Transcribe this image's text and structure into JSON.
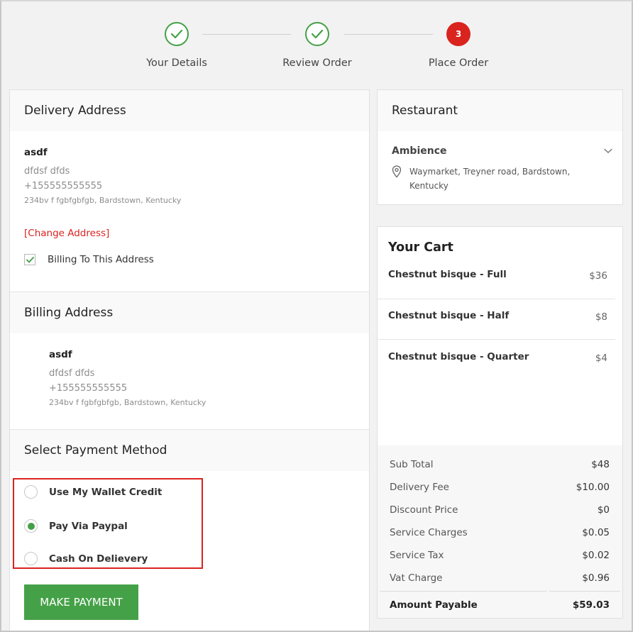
{
  "steps": [
    {
      "label": "Your Details",
      "status": "done"
    },
    {
      "label": "Review Order",
      "status": "done"
    },
    {
      "label": "Place Order",
      "status": "current",
      "number": "3"
    }
  ],
  "delivery": {
    "title": "Delivery Address",
    "name": "asdf",
    "line1": "dfdsf dfds",
    "phone": "+155555555555",
    "address": "234bv f fgbfgbfgb, Bardstown, Kentucky",
    "change_link": "[Change Address]",
    "billing_checkbox_label": "Billing To This Address",
    "billing_checked": true
  },
  "billing": {
    "title": "Billing Address",
    "name": "asdf",
    "line1": "dfdsf dfds",
    "phone": "+155555555555",
    "address": "234bv f fgbfgbfgb, Bardstown, Kentucky"
  },
  "payment": {
    "title": "Select Payment Method",
    "options": [
      {
        "label": "Use My Wallet Credit",
        "selected": false
      },
      {
        "label": "Pay Via Paypal",
        "selected": true
      },
      {
        "label": "Cash On Delievery",
        "selected": false
      }
    ],
    "button_label": "MAKE PAYMENT"
  },
  "restaurant": {
    "title": "Restaurant",
    "name": "Ambience",
    "address_line1": "Waymarket, Treyner road, Bardstown,",
    "address_line2": "Kentucky"
  },
  "cart": {
    "title": "Your Cart",
    "items": [
      {
        "name": "Chestnut bisque - Full",
        "price": "$36"
      },
      {
        "name": "Chestnut bisque - Half",
        "price": "$8"
      },
      {
        "name": "Chestnut bisque - Quarter",
        "price": "$4"
      }
    ],
    "totals": [
      {
        "label": "Sub Total",
        "value": "$48"
      },
      {
        "label": "Delivery Fee",
        "value": "$10.00"
      },
      {
        "label": "Discount Price",
        "value": "$0"
      },
      {
        "label": "Service Charges",
        "value": "$0.05"
      },
      {
        "label": "Service Tax",
        "value": "$0.02"
      },
      {
        "label": "Vat Charge",
        "value": "$0.96"
      }
    ],
    "payable_label": "Amount Payable",
    "payable_value": "$59.03"
  },
  "colors": {
    "accent_green": "#44a046",
    "accent_red": "#d9231f"
  }
}
